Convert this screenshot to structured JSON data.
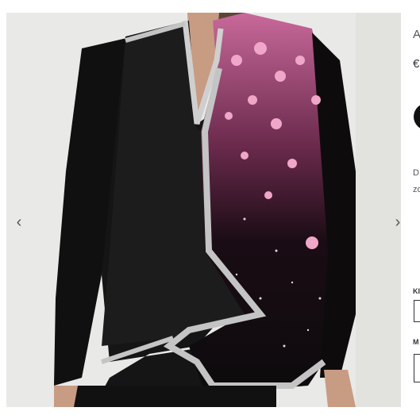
{
  "product": {
    "image_alt": "Black long-sleeve blouse with pink floral glitter panel",
    "title_fragment": "A",
    "price_fragment": "€",
    "desc_line1": "D",
    "desc_line2": "zo",
    "label_k": "KI",
    "label_m": "M"
  },
  "gallery": {
    "prev_icon": "‹",
    "next_icon": "›"
  },
  "colors": {
    "garment": "#141414",
    "petal": "#e48fb7",
    "glitter": "#c9c9c9",
    "background": "#e9e9e7"
  }
}
